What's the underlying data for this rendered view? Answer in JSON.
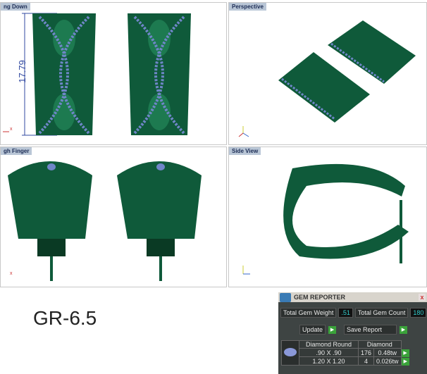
{
  "viewports": [
    {
      "label": "ng Down",
      "dimension": "17.79",
      "axis": "x"
    },
    {
      "label": "Perspective",
      "axes": [
        "z",
        "x",
        "y"
      ]
    },
    {
      "label": "gh Finger",
      "axis": "x"
    },
    {
      "label": "Side View",
      "axes": [
        "z",
        "y"
      ]
    }
  ],
  "model_code": "GR-6.5",
  "gem_reporter": {
    "title": "GEM REPORTER",
    "close": "x",
    "total_weight_label": "Total Gem Weight",
    "total_weight": ".51",
    "total_count_label": "Total Gem Count",
    "total_count": "180",
    "update_label": "Update",
    "save_label": "Save Report",
    "table_headers": [
      "Diamond Round",
      "Diamond"
    ],
    "rows": [
      {
        "size": ".90 X .90",
        "count": "176",
        "weight": "0.48tw"
      },
      {
        "size": "1.20 X 1.20",
        "count": "4",
        "weight": "0.026tw"
      }
    ]
  },
  "colors": {
    "metal": "#0f5a3a",
    "gem": "#6f86c8",
    "dimension": "#3048a0"
  }
}
